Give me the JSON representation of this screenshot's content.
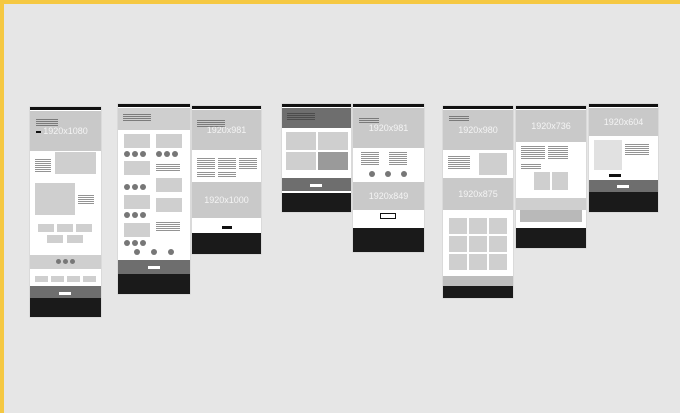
{
  "canvas": {
    "background": "#e6e6e6",
    "frame_accent": "#f5c842"
  },
  "boards": [
    {
      "id": "home",
      "hero": "1920x1080"
    },
    {
      "id": "listing",
      "hero": ""
    },
    {
      "id": "detail",
      "hero": "1920x981",
      "mid": "1920x1000"
    },
    {
      "id": "gallery",
      "hero": ""
    },
    {
      "id": "about",
      "hero": "1920x981",
      "mid": "1920x849"
    },
    {
      "id": "services",
      "hero": "1920x980",
      "mid": "1920x875"
    },
    {
      "id": "service-detail",
      "hero": "1920x736"
    },
    {
      "id": "contact",
      "hero": "1920x604"
    }
  ]
}
